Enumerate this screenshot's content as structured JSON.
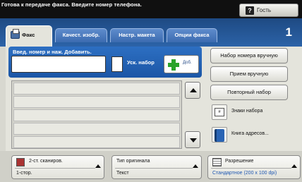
{
  "status": {
    "text": "Готова к передаче факса. Введите номер телефона."
  },
  "user": {
    "guest_label": "Гость",
    "help_glyph": "?"
  },
  "tabs": [
    {
      "label": "Факс",
      "icon": "fax-icon",
      "active": true
    },
    {
      "label": "Качест. изобр.",
      "active": false
    },
    {
      "label": "Настр. макета",
      "active": false
    },
    {
      "label": "Опции факса",
      "active": false
    }
  ],
  "page_number": "1",
  "entry": {
    "label": "Введ. номер и наж. Добавить.",
    "number_value": "",
    "speed_dial_label": "Уск. набор",
    "speed_dial_value": "",
    "add_label": "Доб."
  },
  "recipients": [],
  "side_buttons": {
    "manual_dial": "Набор номера вручную",
    "manual_receive": "Прием вручную",
    "redial": "Повторный набор",
    "dial_chars": "Знаки набора",
    "address_book": "Книга адресов..."
  },
  "bottom": {
    "scan": {
      "title": "2-ст. сканиров.",
      "value": "1-стор."
    },
    "original": {
      "title": "Тип оригинала",
      "value": "Текст"
    },
    "resolution": {
      "title": "Разрешение",
      "value": "Стандартное (200 x 100 dpi)"
    }
  },
  "colors": {
    "tab_bar": "#2c63a8",
    "accent_green": "#2aa32a",
    "entry_panel": "#1b56a6"
  }
}
